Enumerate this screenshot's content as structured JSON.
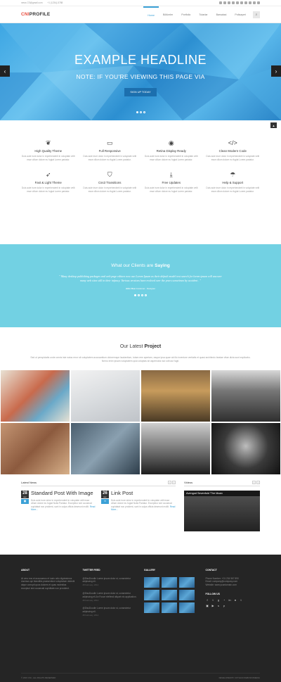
{
  "topbar": {
    "email": "news CS@gmail.com",
    "phone": "+1 (1234)-5788"
  },
  "logo": {
    "part1": "CNI",
    "part2": "PROFILE"
  },
  "menu": [
    "Home",
    "Bölümler",
    "Portfolio",
    "Tutarlar",
    "Barsalasi",
    "Polisayeri"
  ],
  "hero": {
    "headline": "EXAMPLE HEADLINE",
    "sub": "NOTE: IF YOU'RE VIEWING THIS PAGE VIA",
    "button": "SIGN UP TODAY",
    "prev": "‹",
    "next": "›"
  },
  "features": [
    {
      "icon": "leaf-icon",
      "glyph": "❦",
      "title": "High Quality Theme",
      "desc": "Duis aute irure dolor in reprehenderit in voluptate velit esse cillum dolore eu fugiat Lorem pariatur."
    },
    {
      "icon": "monitor-icon",
      "glyph": "▭",
      "title": "Full Responsive",
      "desc": "Duis aute irure dolor in reprehenderit in voluptate velit esse cillum dolore eu fugiat Lorem pariatur."
    },
    {
      "icon": "eye-icon",
      "glyph": "◉",
      "title": "Retina Display Ready",
      "desc": "Duis aute irure dolor in reprehenderit in voluptate velit esse cillum dolore eu fugiat Lorem pariatur."
    },
    {
      "icon": "code-icon",
      "glyph": "</>",
      "title": "Clean Modern Code",
      "desc": "Duis aute irure dolor in reprehenderit in voluptate velit esse cillum dolore eu fugiat Lorem pariatur."
    },
    {
      "icon": "rocket-icon",
      "glyph": "➶",
      "title": "Fast & Light Theme",
      "desc": "Duis aute irure dolor in reprehenderit in voluptate velit esse cillum dolore eu fugiat Lorem pariatur."
    },
    {
      "icon": "css3-icon",
      "glyph": "⛉",
      "title": "Css3 Transitions",
      "desc": "Duis aute irure dolor in reprehenderit in voluptate velit esse cillum dolore eu fugiat Lorem pariatur."
    },
    {
      "icon": "download-icon",
      "glyph": "⤓",
      "title": "Free Updates",
      "desc": "Duis aute irure dolor in reprehenderit in voluptate velit esse cillum dolore eu fugiat Lorem pariatur."
    },
    {
      "icon": "umbrella-icon",
      "glyph": "☂",
      "title": "Help & Support",
      "desc": "Duis aute irure dolor in reprehenderit in voluptate velit esse cillum dolore eu fugiat Lorem pariatur."
    }
  ],
  "testimonial": {
    "heading": "What our Clients are",
    "heading_bold": "Saying",
    "quote": "\" Many desktop publishing packages and web page editors now use Lorem Ipsum as their default model text search for lorem ipsum will uncover many web sites still in their infancy. Various versions have evolved over the years sometimes by accident . \"",
    "name": "John Doe",
    "role": "Customer - Designer"
  },
  "project": {
    "heading": "Our Latest",
    "heading_bold": "Project",
    "desc": "Sed ut perspiciatis unde omnis iste natus error sit voluptatem accusantium doloremque laudantium, totam rem aperiam, eaque ipsa quae ab illo inventore veritatis et quasi architecto beatae vitae dicta sunt explicabo. Nemo enim ipsam voluptatem quia voluptas sit aspernatur aut odit aut fugit."
  },
  "news": {
    "heading": "Latest News",
    "posts": [
      {
        "day": "28",
        "month": "DEC",
        "title": "Standard Post With Image",
        "desc": "Duis aute irure dolor in reprehenderit in voluptate velit esse cillum dolore eu fugiat Nulla Pariatur. Excepteur sint occaecat cupidatat non proident, sunt in culpa officia deserunt mollit.",
        "more": "Read More..."
      },
      {
        "day": "26",
        "month": "DEC",
        "title": "Link Post",
        "desc": "Duis aute irure dolor in reprehenderit in voluptate velit esse cillum dolore eu fugiat Nulla Pariatur. Excepteur sint occaecat cupidatat non proident, sunt in culpa officia deserunt mollit.",
        "more": "Read More..."
      }
    ]
  },
  "videos": {
    "heading": "Videos",
    "title": "Avengod Sevenfold 'The Moan"
  },
  "footer": {
    "about_h": "ABOUT",
    "about": "At vero eos et accusamus et iusto odio dignissimos ducimus qui blanditiis praesentium voluptatum deleniti atque corrupti quos dolores et quas molestias excepturi sint occaecati cupiditate non provident.",
    "twitter_h": "TWITTER FEED",
    "tweets": [
      {
        "text": "@DiscDoodle Lorem ipsum dolor st, consectetur adipiscing eli.",
        "date": "28 February, 2014"
      },
      {
        "text": "@DiscDoodle Lorem ipsum dolor st, consectetur adipiscing eli.An Fusce eleifend aliquet nis application.",
        "date": "28 February, 2014"
      },
      {
        "text": "@DiscDoodle Lorem ipsum dolor st, consectetur adipiscing eli.",
        "date": "28 February, 2014"
      }
    ],
    "gallery_h": "GALLERY",
    "contact_h": "CONTACT",
    "phone": "Phone Number: +01 234 567 890",
    "email": "Email: company@company.com",
    "website": "Website: www.yourdomain.com",
    "follow_h": "FOLLOW US",
    "copyright": "© 2015 CNI - ALL RIGHTS RESERVED",
    "developed": "DEVELOPED BY COTHANI WEB INFOMEDIA"
  }
}
